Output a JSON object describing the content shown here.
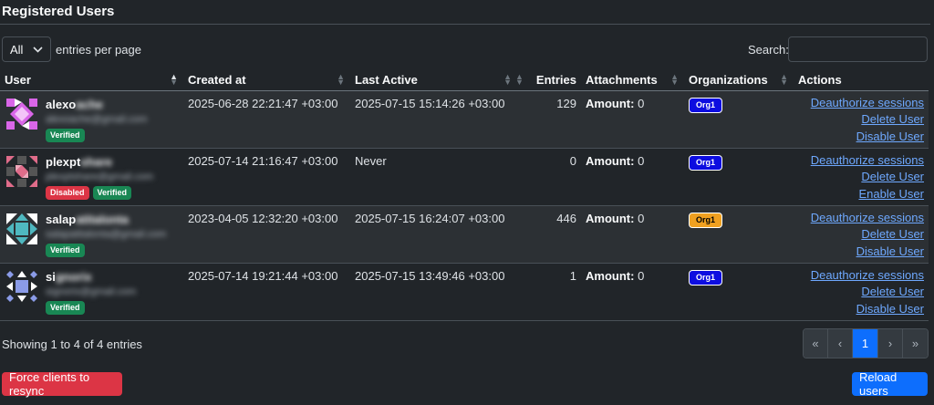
{
  "page": {
    "title": "Registered Users"
  },
  "length_menu": {
    "selected": "All",
    "label": "entries per page"
  },
  "search": {
    "label": "Search:",
    "value": ""
  },
  "table": {
    "headers": {
      "user": "User",
      "created_at": "Created at",
      "last_active": "Last Active",
      "entries": "Entries",
      "attachments": "Attachments",
      "organizations": "Organizations",
      "actions": "Actions"
    },
    "rows": [
      {
        "name_visible": "alexo",
        "name_blurred": "ache",
        "email": "alexoache@gmail.com",
        "badges": [
          "Verified"
        ],
        "created_at": "2025-06-28 22:21:47 +03:00",
        "last_active": "2025-07-15 15:14:26 +03:00",
        "entries": "129",
        "amount_label": "Amount:",
        "amount": "0",
        "org": "Org1",
        "actions": [
          "Deauthorize sessions",
          "Delete User",
          "Disable User"
        ]
      },
      {
        "name_visible": "plexpt",
        "name_blurred": "share",
        "email": "plexptshare@gmail.com",
        "badges": [
          "Disabled",
          "Verified"
        ],
        "created_at": "2025-07-14 21:16:47 +03:00",
        "last_active": "Never",
        "entries": "0",
        "amount_label": "Amount:",
        "amount": "0",
        "org": "Org1",
        "actions": [
          "Deauthorize sessions",
          "Delete User",
          "Enable User"
        ]
      },
      {
        "name_visible": "salap",
        "name_blurred": "atitalonta",
        "email": "salapatitalonta@gmail.com",
        "badges": [
          "Verified"
        ],
        "created_at": "2023-04-05 12:32:20 +03:00",
        "last_active": "2025-07-15 16:24:07 +03:00",
        "entries": "446",
        "amount_label": "Amount:",
        "amount": "0",
        "org": "Org1",
        "actions": [
          "Deauthorize sessions",
          "Delete User",
          "Disable User"
        ]
      },
      {
        "name_visible": "si",
        "name_blurred": "gnorix",
        "email": "signorix@gmail.com",
        "badges": [
          "Verified"
        ],
        "created_at": "2025-07-14 19:21:44 +03:00",
        "last_active": "2025-07-15 13:49:46 +03:00",
        "entries": "1",
        "amount_label": "Amount:",
        "amount": "0",
        "org": "Org1",
        "actions": [
          "Deauthorize sessions",
          "Delete User",
          "Disable User"
        ]
      }
    ]
  },
  "info": "Showing 1 to 4 of 4 entries",
  "pagination": {
    "first": "«",
    "prev": "‹",
    "current": "1",
    "next": "›",
    "last": "»"
  },
  "buttons": {
    "resync": "Force clients to resync",
    "reload": "Reload users"
  },
  "colors": {
    "org_blue": "#0d0de0",
    "org_orange": "#f0a020",
    "verified": "#198754",
    "disabled": "#dc3545",
    "primary": "#0d6efd",
    "link": "#6ea8fe"
  },
  "icons": {
    "length_select": "chevron-down-icon",
    "avatars": [
      "identicon-avatar-pink",
      "identicon-avatar-rose",
      "identicon-avatar-teal",
      "identicon-avatar-blue"
    ]
  }
}
